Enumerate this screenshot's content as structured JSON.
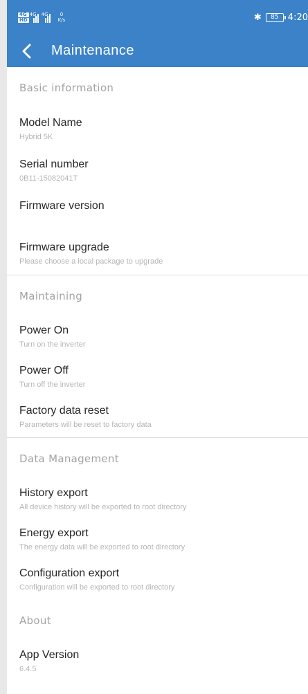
{
  "status_bar": {
    "sim1": "4G",
    "sim2": "HD",
    "signal1_label": "4G",
    "signal2_label": "4G",
    "speed_value": "0",
    "speed_unit": "K/s",
    "bluetooth_icon": "bluetooth-icon",
    "battery": "85",
    "time": "4:20"
  },
  "app_bar": {
    "back_icon": "chevron-left-icon",
    "title": "Maintenance"
  },
  "colors": {
    "primary": "#3b82c9",
    "section_header": "#a3a3a3",
    "title": "#262626",
    "subtitle": "#b5b5b5"
  },
  "basic": {
    "header": "Basic information",
    "model_title": "Model Name",
    "model_value": "Hybrid 5K",
    "serial_title": "Serial number",
    "serial_value": "0B11-15082041T",
    "firmware_title": "Firmware version",
    "firmware_value": "",
    "upgrade_title": "Firmware upgrade",
    "upgrade_sub": "Please choose a local package to upgrade"
  },
  "maintaining": {
    "header": "Maintaining",
    "power_on_title": "Power On",
    "power_on_sub": "Turn on the inverter",
    "power_off_title": "Power Off",
    "power_off_sub": "Turn off the inverter",
    "reset_title": "Factory data reset",
    "reset_sub": "Parameters will be reset to factory data"
  },
  "data_management": {
    "header": "Data Management",
    "history_title": "History export",
    "history_sub": "All device history will be exported to root directory",
    "energy_title": "Energy export",
    "energy_sub": "The energy data will be exported to root directory",
    "config_title": "Configuration export",
    "config_sub": "Configuration will be exported to root directory"
  },
  "about": {
    "header": "About",
    "version_title": "App Version",
    "version_value": "6.4.5"
  }
}
